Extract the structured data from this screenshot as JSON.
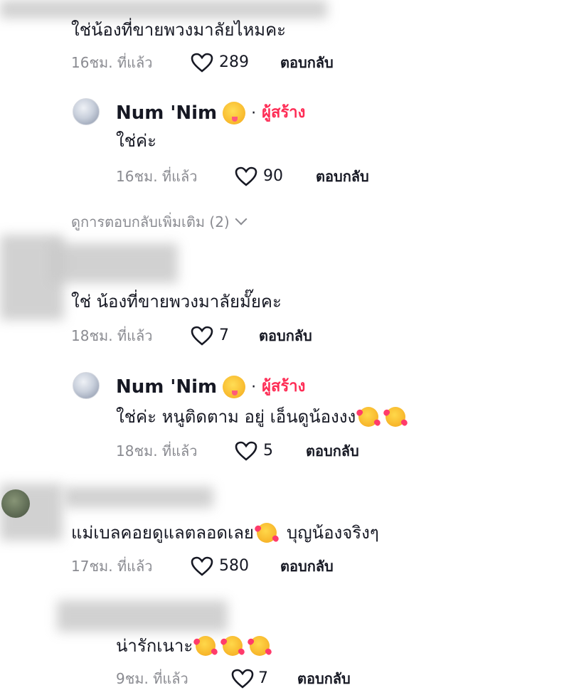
{
  "comments": [
    {
      "text": "ใช่น้องที่ขายพวงมาลัยไหมคะ",
      "time": "16ชม. ที่แล้ว",
      "likes": "289",
      "reply_label": "ตอบกลับ"
    },
    {
      "username": "Num 'Nim",
      "creator_label": "ผู้สร้าง",
      "dot": "·",
      "text": "ใช่ค่ะ",
      "time": "16ชม. ที่แล้ว",
      "likes": "90",
      "reply_label": "ตอบกลับ"
    },
    {
      "more_replies": "ดูการตอบกลับเพิ่มเติม (2)"
    },
    {
      "text": "ใช่ น้องที่ขายพวงมาลัยมั๊ยคะ",
      "time": "18ชม. ที่แล้ว",
      "likes": "7",
      "reply_label": "ตอบกลับ"
    },
    {
      "username": "Num 'Nim",
      "creator_label": "ผู้สร้าง",
      "dot": "·",
      "text": "ใช่ค่ะ หนูติดตาม อยู่ เอ็นดูน้องงง",
      "time": "18ชม. ที่แล้ว",
      "likes": "5",
      "reply_label": "ตอบกลับ"
    },
    {
      "text_before": "แม่เบลคอยดูแลตลอดเลย",
      "text_after": "บุญน้องจริงๆ",
      "time": "17ชม. ที่แล้ว",
      "likes": "580",
      "reply_label": "ตอบกลับ"
    },
    {
      "text": "น่ารักเนาะ",
      "time": "9ชม. ที่แล้ว",
      "likes": "7",
      "reply_label": "ตอบกลับ"
    }
  ],
  "icons": {
    "heart": "heart-outline-icon",
    "creator_emoji": "winking-face-tongue-emoji",
    "love_emoji": "smiling-face-with-hearts-emoji",
    "chevron": "chevron-down-icon"
  },
  "colors": {
    "creator": "#fe2c55",
    "meta": "#8a8b91",
    "text": "#161823"
  }
}
